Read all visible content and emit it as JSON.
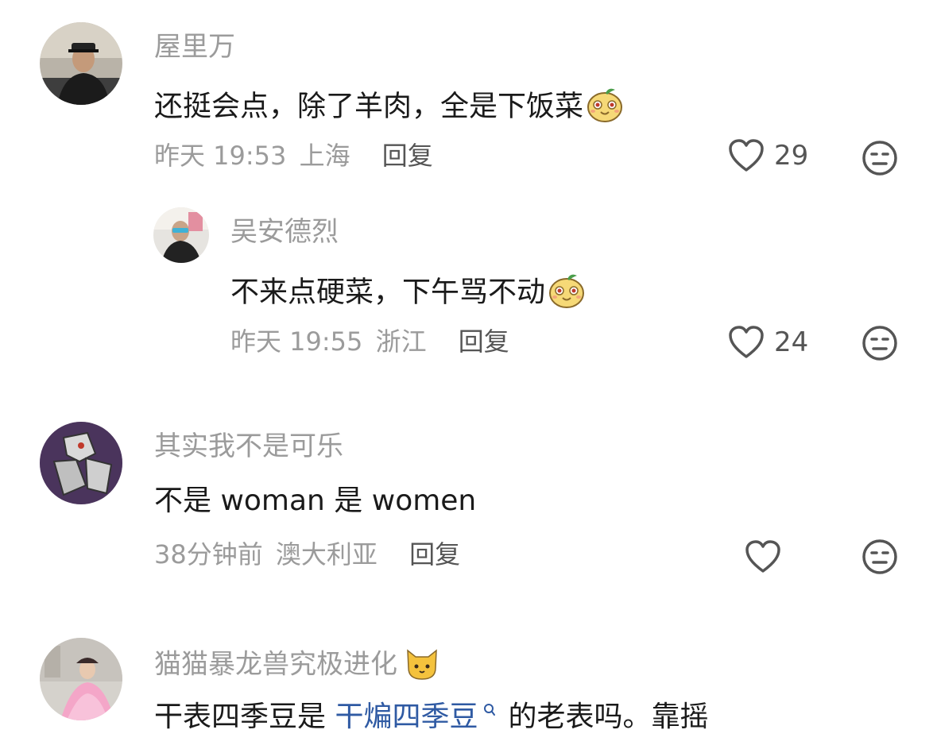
{
  "comments": [
    {
      "username": "屋里万",
      "text": "还挺会点，除了羊肉，全是下饭菜",
      "time": "昨天 19:53",
      "location": "上海",
      "reply_label": "回复",
      "likes": "29",
      "emoji": "mango-face-emoji"
    },
    {
      "username": "吴安德烈",
      "text": "不来点硬菜，下午骂不动",
      "time": "昨天 19:55",
      "location": "浙江",
      "reply_label": "回复",
      "likes": "24",
      "emoji": "mango-face-emoji"
    },
    {
      "username": "其实我不是可乐",
      "text": "不是 woman 是 women",
      "time": "38分钟前",
      "location": "澳大利亚",
      "reply_label": "回复",
      "likes": ""
    },
    {
      "username": "猫猫暴龙兽究极进化",
      "username_emoji": "cat-face-emoji",
      "text_before": "干表四季豆是 ",
      "text_link": "干煸四季豆",
      "text_after": " 的老表吗。",
      "text_trailing": "靠摇"
    }
  ],
  "icons": {
    "like": "heart-outline-icon",
    "dislike": "neutral-face-icon",
    "search": "search-icon"
  },
  "colors": {
    "text": "#1a1a1a",
    "meta": "#9b9b9b",
    "link": "#2f5aa3",
    "icon": "#555555"
  }
}
